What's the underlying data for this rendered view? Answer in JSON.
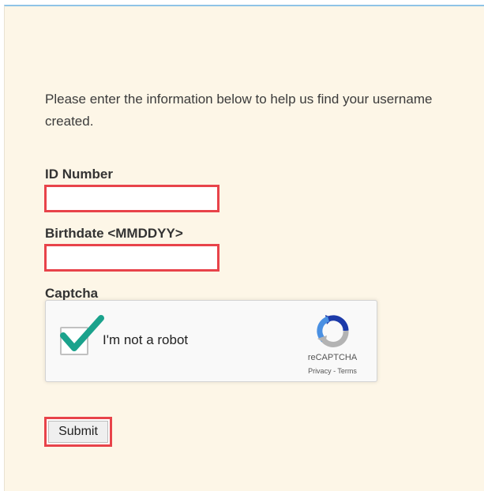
{
  "intro": {
    "line1": "Please enter the information below to help us find your username",
    "line2": "created."
  },
  "form": {
    "id_number": {
      "label": "ID Number",
      "value": "",
      "placeholder": ""
    },
    "birthdate": {
      "label": "Birthdate <MMDDYY>",
      "value": "",
      "placeholder": ""
    },
    "captcha": {
      "label": "Captcha",
      "checkbox_text": "I'm not a robot",
      "checked": true,
      "brand": "reCAPTCHA",
      "privacy_link": "Privacy",
      "separator": " - ",
      "terms_link": "Terms"
    },
    "submit_label": "Submit"
  },
  "colors": {
    "panel_bg": "#fdf6e7",
    "highlight_border": "#e8434a",
    "check_green": "#1aa28c",
    "top_rule": "#8fc3e6"
  },
  "icons": {
    "check": "check-icon",
    "recaptcha_logo": "recaptcha-logo-icon"
  }
}
